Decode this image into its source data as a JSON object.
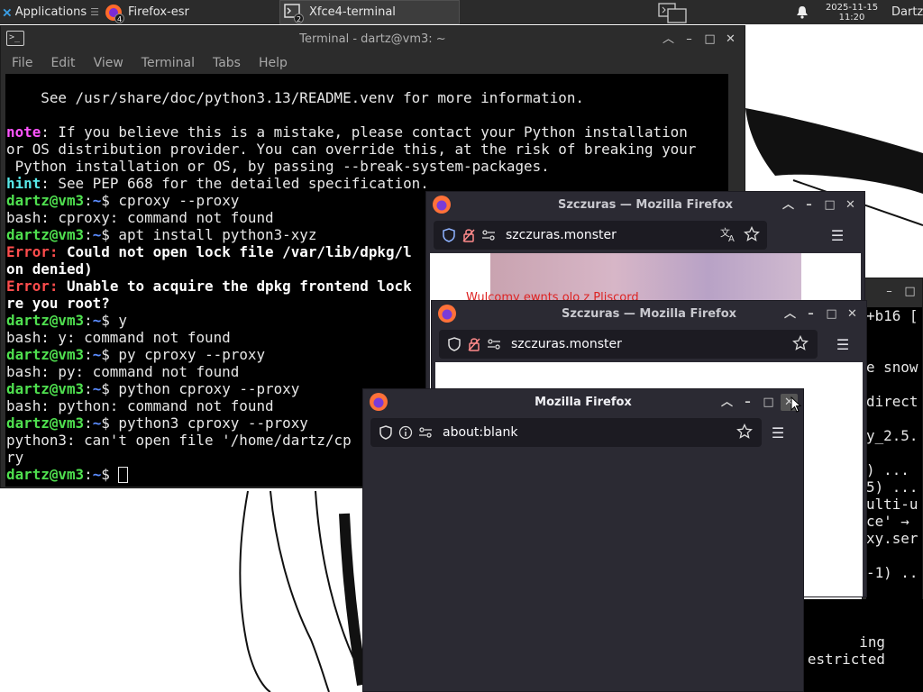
{
  "panel": {
    "apps_label": "Applications",
    "tasks": [
      {
        "label": "Firefox-esr",
        "badge": "4"
      },
      {
        "label": "Xfce4-terminal",
        "badge": "2"
      }
    ],
    "clock_date": "2025-11-15",
    "clock_time": "11:20",
    "user": "Dartz"
  },
  "terminal": {
    "title": "Terminal - dartz@vm3: ~",
    "menu": [
      "File",
      "Edit",
      "View",
      "Terminal",
      "Tabs",
      "Help"
    ],
    "lines": [
      {
        "segs": [
          {
            "t": "    See /usr/share/doc/python3.13/README.venv for more information.",
            "c": ""
          }
        ]
      },
      {
        "segs": [
          {
            "t": "",
            "c": ""
          }
        ]
      },
      {
        "segs": [
          {
            "t": "note",
            "c": "magenta"
          },
          {
            "t": ": If you believe this is a mistake, please contact your Python installation",
            "c": ""
          }
        ]
      },
      {
        "segs": [
          {
            "t": "or OS distribution provider. You can override this, at the risk of breaking your",
            "c": ""
          }
        ]
      },
      {
        "segs": [
          {
            "t": " Python installation or OS, by passing --break-system-packages.",
            "c": ""
          }
        ]
      },
      {
        "segs": [
          {
            "t": "hint",
            "c": "cyan"
          },
          {
            "t": ": See PEP 668 for the detailed specification.",
            "c": ""
          }
        ]
      },
      {
        "segs": [
          {
            "t": "dartz@vm3",
            "c": "green"
          },
          {
            "t": ":",
            "c": ""
          },
          {
            "t": "~",
            "c": "blue"
          },
          {
            "t": "$ cproxy --proxy",
            "c": ""
          }
        ]
      },
      {
        "segs": [
          {
            "t": "bash: cproxy: command not found",
            "c": ""
          }
        ]
      },
      {
        "segs": [
          {
            "t": "dartz@vm3",
            "c": "green"
          },
          {
            "t": ":",
            "c": ""
          },
          {
            "t": "~",
            "c": "blue"
          },
          {
            "t": "$ apt install python3-xyz",
            "c": ""
          }
        ]
      },
      {
        "segs": [
          {
            "t": "Error: ",
            "c": "red"
          },
          {
            "t": "Could not open lock file /var/lib/dpkg/l",
            "c": "bold"
          }
        ]
      },
      {
        "segs": [
          {
            "t": "on denied)",
            "c": "bold"
          }
        ]
      },
      {
        "segs": [
          {
            "t": "Error: ",
            "c": "red"
          },
          {
            "t": "Unable to acquire the dpkg frontend lock",
            "c": "bold"
          }
        ]
      },
      {
        "segs": [
          {
            "t": "re you root?",
            "c": "bold"
          }
        ]
      },
      {
        "segs": [
          {
            "t": "dartz@vm3",
            "c": "green"
          },
          {
            "t": ":",
            "c": ""
          },
          {
            "t": "~",
            "c": "blue"
          },
          {
            "t": "$ y",
            "c": ""
          }
        ]
      },
      {
        "segs": [
          {
            "t": "bash: y: command not found",
            "c": ""
          }
        ]
      },
      {
        "segs": [
          {
            "t": "dartz@vm3",
            "c": "green"
          },
          {
            "t": ":",
            "c": ""
          },
          {
            "t": "~",
            "c": "blue"
          },
          {
            "t": "$ py cproxy --proxy",
            "c": ""
          }
        ]
      },
      {
        "segs": [
          {
            "t": "bash: py: command not found",
            "c": ""
          }
        ]
      },
      {
        "segs": [
          {
            "t": "dartz@vm3",
            "c": "green"
          },
          {
            "t": ":",
            "c": ""
          },
          {
            "t": "~",
            "c": "blue"
          },
          {
            "t": "$ python cproxy --proxy",
            "c": ""
          }
        ]
      },
      {
        "segs": [
          {
            "t": "bash: python: command not found",
            "c": ""
          }
        ]
      },
      {
        "segs": [
          {
            "t": "dartz@vm3",
            "c": "green"
          },
          {
            "t": ":",
            "c": ""
          },
          {
            "t": "~",
            "c": "blue"
          },
          {
            "t": "$ python3 cproxy --proxy",
            "c": ""
          }
        ]
      },
      {
        "segs": [
          {
            "t": "python3: can't open file '/home/dartz/cp",
            "c": ""
          }
        ]
      },
      {
        "segs": [
          {
            "t": "ry",
            "c": ""
          }
        ]
      },
      {
        "segs": [
          {
            "t": "dartz@vm3",
            "c": "green"
          },
          {
            "t": ":",
            "c": ""
          },
          {
            "t": "~",
            "c": "blue"
          },
          {
            "t": "$ ",
            "c": ""
          }
        ],
        "cursor": true
      }
    ]
  },
  "terminal2": {
    "lines": [
      "+b16 [",
      "",
      "",
      "e snow",
      "",
      "direct",
      "",
      "y_2.5.",
      "",
      ") ...",
      "5) ...",
      "ulti-u",
      "ce' →",
      "xy.ser",
      "",
      "-1) ..",
      "",
      "",
      "ing",
      "estricted"
    ]
  },
  "firefox": [
    {
      "title": "Szczuras — Mozilla Firefox",
      "url": "szczuras.monster",
      "page_text": "Wulcomy ewnts olo z Pliscord"
    },
    {
      "title": "Szczuras — Mozilla Firefox",
      "url": "szczuras.monster"
    },
    {
      "title": "Mozilla Firefox",
      "url": "about:blank"
    }
  ]
}
